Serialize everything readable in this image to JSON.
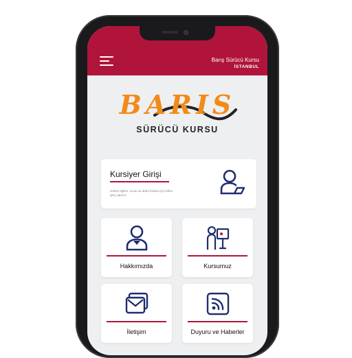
{
  "header": {
    "brand_name": "Barış Sürücü Kursu",
    "brand_city": "İSTANBUL",
    "menu_icon": "hamburger-menu-icon"
  },
  "logo": {
    "wordmark": "BARIS",
    "subtitle": "SÜRÜCÜ KURSU"
  },
  "login_card": {
    "title": "Kursiyer Girişi",
    "description": "Online eğitim, sınav ve daha fazlası için lütfen giriş yapınız",
    "icon": "user-login-icon"
  },
  "tiles": [
    {
      "label": "Hakkımızda",
      "icon": "person-icon"
    },
    {
      "label": "Kursumuz",
      "icon": "instructor-board-icon"
    },
    {
      "label": "İletişim",
      "icon": "mail-icon"
    },
    {
      "label": "Duyuru ve Haberler",
      "icon": "rss-feed-icon"
    }
  ],
  "colors": {
    "accent": "#b0143a",
    "logo_orange": "#f28a1a",
    "icon_navy": "#1f2c6e",
    "screen_bg": "#eeeff1"
  }
}
